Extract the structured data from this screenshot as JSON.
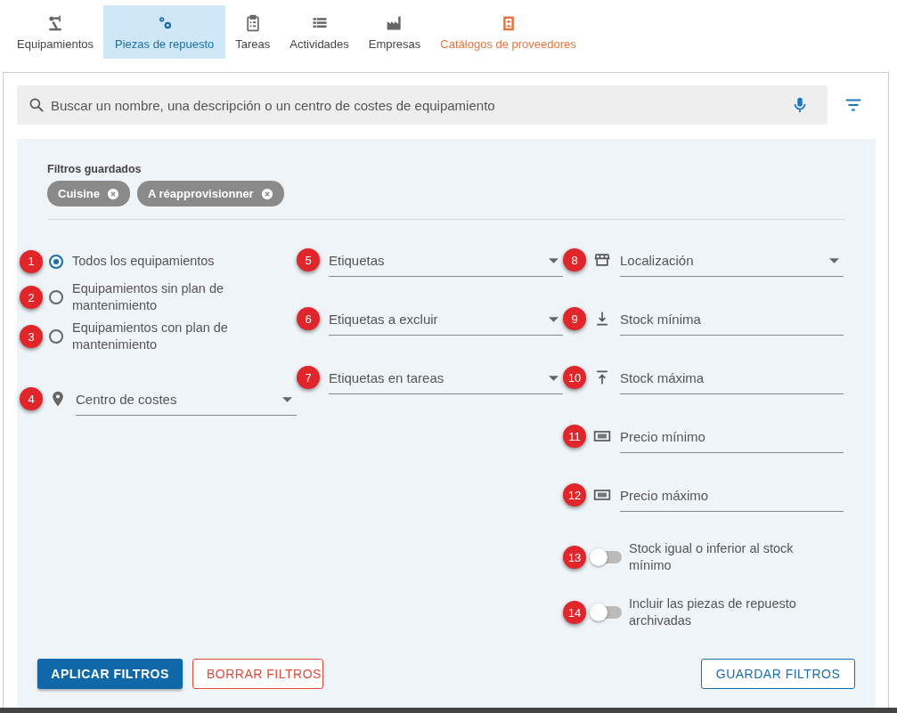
{
  "tabs": [
    {
      "label": "Equipamientos",
      "selected": false,
      "highlighted": false
    },
    {
      "label": "Piezas de repuesto",
      "selected": true,
      "highlighted": false
    },
    {
      "label": "Tareas",
      "selected": false,
      "highlighted": false
    },
    {
      "label": "Actividades",
      "selected": false,
      "highlighted": false
    },
    {
      "label": "Empresas",
      "selected": false,
      "highlighted": false
    },
    {
      "label": "Catálogos de proveedores",
      "selected": false,
      "highlighted": true
    }
  ],
  "search": {
    "placeholder": "Buscar un nombre, una descripción o un centro de costes de equipamiento"
  },
  "saved_filters": {
    "title": "Filtros guardados",
    "chips": [
      "Cuisine",
      "A réapprovisionner"
    ]
  },
  "radios": [
    {
      "marker": "1",
      "label": "Todos los equipamientos",
      "selected": true
    },
    {
      "marker": "2",
      "label": "Equipamientos sin plan de mantenimiento",
      "selected": false
    },
    {
      "marker": "3",
      "label": "Equipamientos con plan de mantenimiento",
      "selected": false
    }
  ],
  "cost_center": {
    "marker": "4",
    "placeholder": "Centro de costes"
  },
  "tag_fields": [
    {
      "marker": "5",
      "placeholder": "Etiquetas"
    },
    {
      "marker": "6",
      "placeholder": "Etiquetas a excluir"
    },
    {
      "marker": "7",
      "placeholder": "Etiquetas en tareas"
    }
  ],
  "right_fields": [
    {
      "marker": "8",
      "kind": "select",
      "placeholder": "Localización"
    },
    {
      "marker": "9",
      "kind": "text",
      "placeholder": "Stock mínima"
    },
    {
      "marker": "10",
      "kind": "text",
      "placeholder": "Stock máxima"
    },
    {
      "marker": "11",
      "kind": "text",
      "placeholder": "Precio mínimo"
    },
    {
      "marker": "12",
      "kind": "text",
      "placeholder": "Precio máximo"
    }
  ],
  "toggles": [
    {
      "marker": "13",
      "label": "Stock igual o inferior al stock mínimo",
      "on": false
    },
    {
      "marker": "14",
      "label": "Incluir las piezas de repuesto archivadas",
      "on": false
    }
  ],
  "buttons": [
    {
      "kind": "primary",
      "label": "APLICAR FILTROS"
    },
    {
      "kind": "danger",
      "label": "BORRAR FILTROS"
    },
    {
      "kind": "outline",
      "label": "GUARDAR FILTROS"
    }
  ]
}
